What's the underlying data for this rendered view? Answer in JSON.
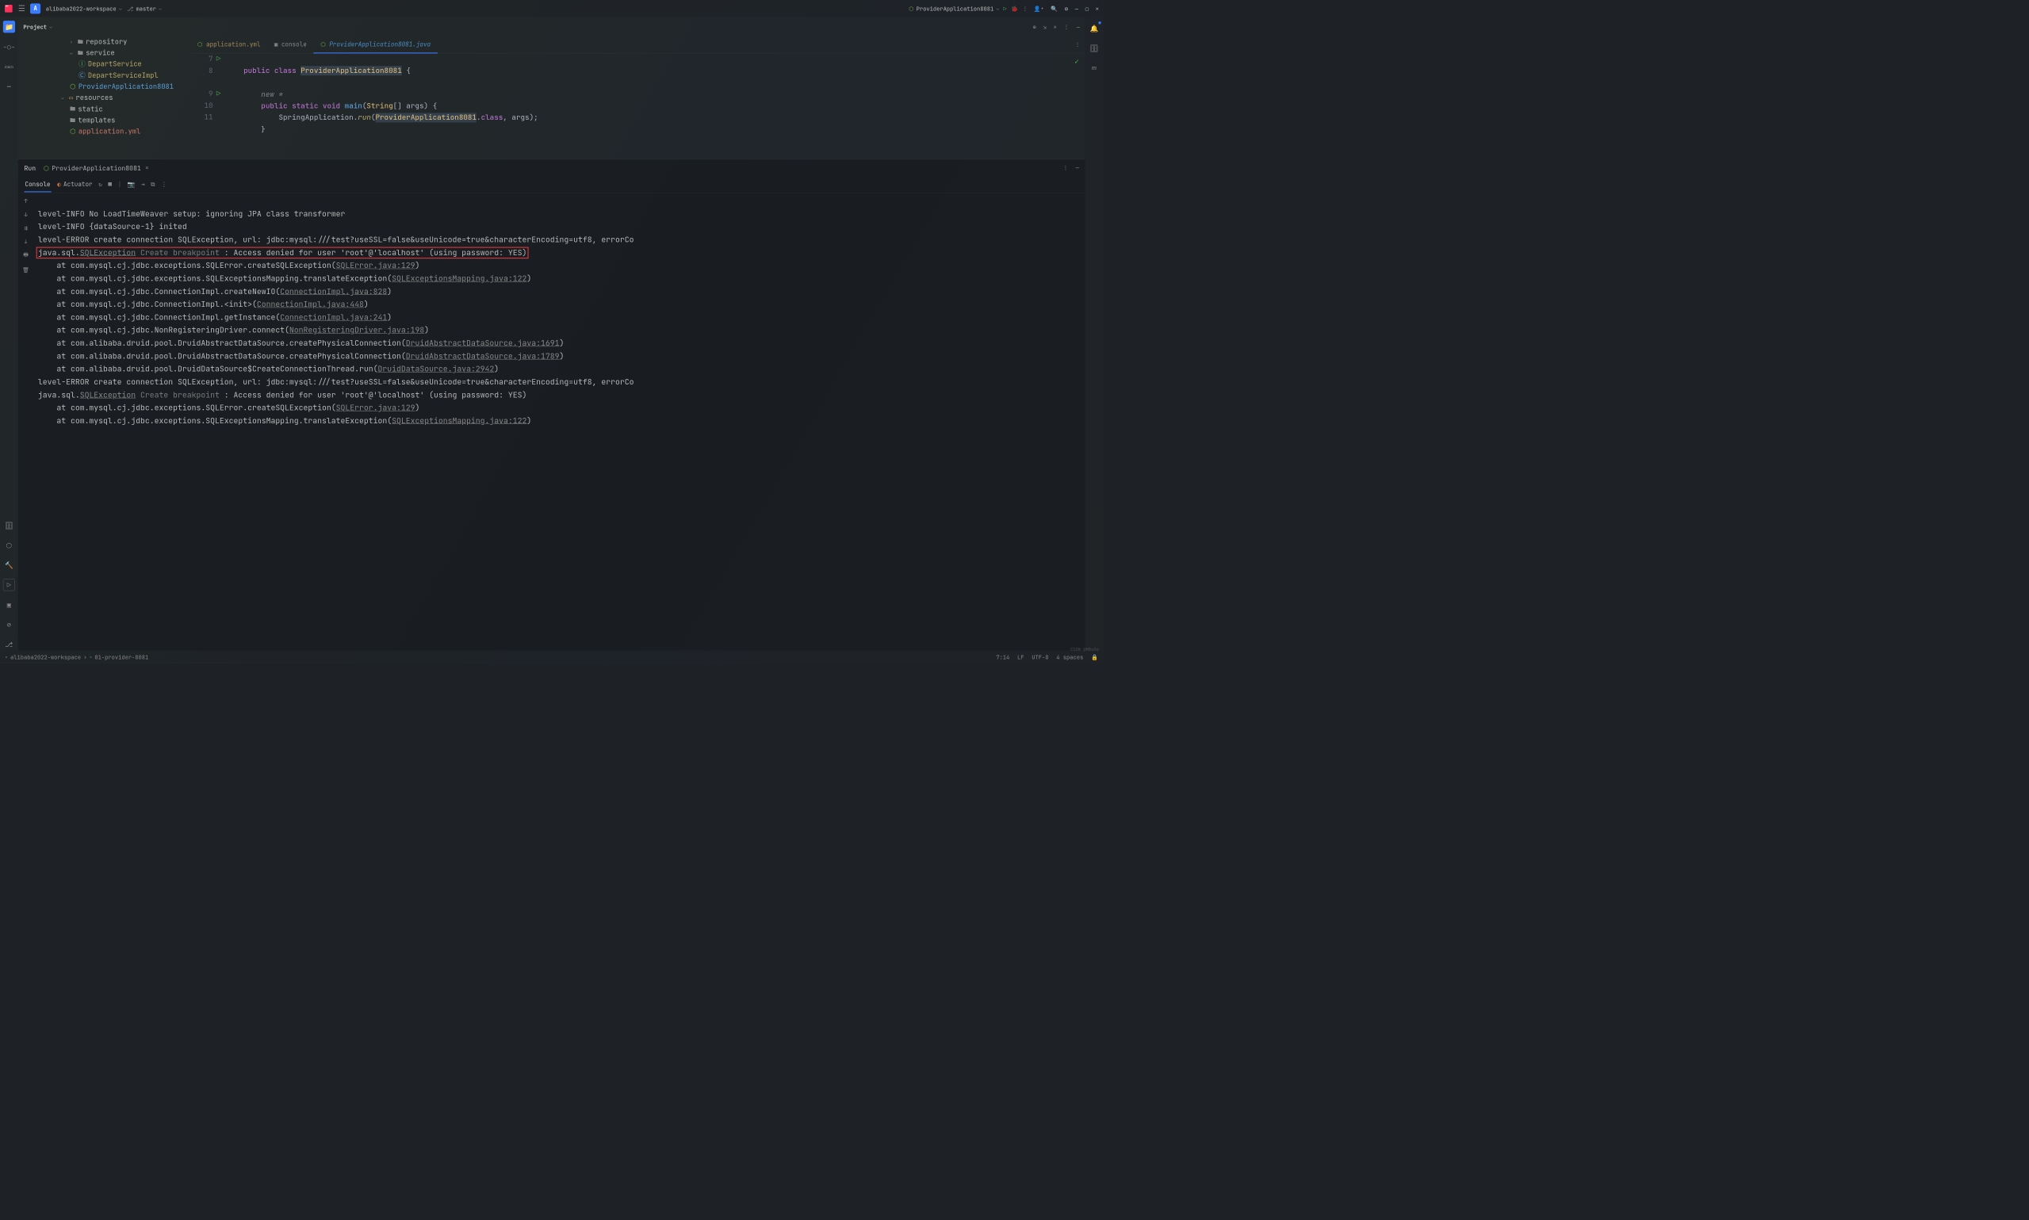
{
  "titlebar": {
    "projectBadge": "A",
    "projectName": "alibaba2022-workspace",
    "branchName": "master",
    "runConfig": "ProviderApplication8081"
  },
  "projectPanel": {
    "title": "Project"
  },
  "tree": {
    "repository": "repository",
    "service": "service",
    "departService": "DepartService",
    "departServiceImpl": "DepartServiceImpl",
    "providerApp": "ProviderApplication8081",
    "resources": "resources",
    "static": "static",
    "templates": "templates",
    "appYml": "application.yml"
  },
  "tabs": {
    "yml": "application.yml",
    "console": "console",
    "active": "ProviderApplication8081.java"
  },
  "code": {
    "ln7": "7",
    "ln8": "8",
    "newstar": "new *",
    "ln9": "9",
    "ln10": "10",
    "ln11": "11",
    "kw_public": "public",
    "kw_class": "class",
    "clsName": "ProviderApplication8081",
    "brace_open": " {",
    "kw_static": "static",
    "kw_void": "void",
    "fn_main": "main",
    "sig_open": "(",
    "type_string": "String",
    "args": "[] args) {",
    "springApp": "SpringApplication",
    "dot": ".",
    "run": "run",
    "runArgs_open": "(",
    "runArgs_close": ".",
    "kw_classR": "class",
    "rest": ", args);",
    "close_brace": "}"
  },
  "runPanel": {
    "label": "Run",
    "tab": "ProviderApplication8081",
    "consoleTab": "Console",
    "actuatorTab": "Actuator"
  },
  "console": {
    "l1": "level-INFO No LoadTimeWeaver setup: ignoring JPA class transformer",
    "l2": "level-INFO {dataSource-1} inited",
    "l3": "level-ERROR create connection SQLException, url: jdbc:mysql:///test?useSSL=false&useUnicode=true&characterEncoding=utf8, errorCo",
    "l4_pre": "java.sql.",
    "l4_exc": "SQLException",
    "l4_create": " Create breakpoint ",
    "l4_rest": ": Access denied for user 'root'@'localhost' (using password: YES)",
    "l5a": "    at com.mysql.cj.jdbc.exceptions.SQLError.createSQLException(",
    "l5b": "SQLError.java:129",
    "l5c": ")",
    "l6a": "    at com.mysql.cj.jdbc.exceptions.SQLExceptionsMapping.translateException(",
    "l6b": "SQLExceptionsMapping.java:122",
    "l6c": ")",
    "l7a": "    at com.mysql.cj.jdbc.ConnectionImpl.createNewIO(",
    "l7b": "ConnectionImpl.java:828",
    "l7c": ")",
    "l8a": "    at com.mysql.cj.jdbc.ConnectionImpl.<init>(",
    "l8b": "ConnectionImpl.java:448",
    "l8c": ")",
    "l9a": "    at com.mysql.cj.jdbc.ConnectionImpl.getInstance(",
    "l9b": "ConnectionImpl.java:241",
    "l9c": ")",
    "l10a": "    at com.mysql.cj.jdbc.NonRegisteringDriver.connect(",
    "l10b": "NonRegisteringDriver.java:198",
    "l10c": ")",
    "l11a": "    at com.alibaba.druid.pool.DruidAbstractDataSource.createPhysicalConnection(",
    "l11b": "DruidAbstractDataSource.java:1691",
    "l11c": ")",
    "l12a": "    at com.alibaba.druid.pool.DruidAbstractDataSource.createPhysicalConnection(",
    "l12b": "DruidAbstractDataSource.java:1789",
    "l12c": ")",
    "l13a": "    at com.alibaba.druid.pool.DruidDataSource$CreateConnectionThread.run(",
    "l13b": "DruidDataSource.java:2942",
    "l13c": ")",
    "l14": "level-ERROR create connection SQLException, url: jdbc:mysql:///test?useSSL=false&useUnicode=true&characterEncoding=utf8, errorCo",
    "l15_pre": "java.sql.",
    "l15_exc": "SQLException",
    "l15_create": " Create breakpoint ",
    "l15_rest": ": Access denied for user 'root'@'localhost' (using password: YES)",
    "l16a": "    at com.mysql.cj.jdbc.exceptions.SQLError.createSQLException(",
    "l16b": "SQLError.java:129",
    "l16c": ")",
    "l17a": "    at com.mysql.cj.jdbc.exceptions.SQLExceptionsMapping.translateException(",
    "l17b": "SQLExceptionsMapping.java:122",
    "l17c": ")"
  },
  "statusBar": {
    "workspace": "alibaba2022-workspace",
    "module": "01-provider-8081",
    "cursor": "7:14",
    "lf": "LF",
    "encoding": "UTF-8",
    "indent": "4 spaces"
  },
  "watermark": "CSDN @HBoOo"
}
